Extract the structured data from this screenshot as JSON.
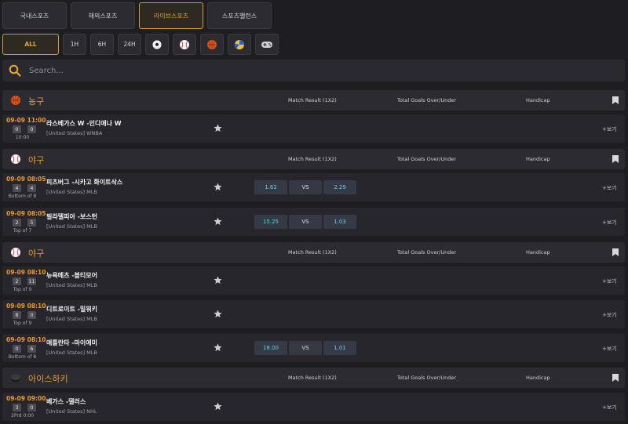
{
  "tabs": [
    "국내스포츠",
    "해외스포츠",
    "라이브스포츠",
    "스포츠밸런스"
  ],
  "active_tab_index": 2,
  "filters": [
    "ALL",
    "1H",
    "6H",
    "24H"
  ],
  "filter_icons": [
    "soccer-icon",
    "baseball-icon",
    "basketball-icon",
    "volleyball-icon",
    "esports-icon"
  ],
  "search": {
    "placeholder": "Search..."
  },
  "columns": {
    "c1": "Match Result (1X2)",
    "c2": "Total Goals Over/Under",
    "c3": "Handicap"
  },
  "more_label": "+보기",
  "odds_vs": "VS",
  "colors": {
    "accent": "#ef9a2b",
    "odds": "#67cfe0"
  },
  "sections": [
    {
      "name": "농구",
      "icon": "basketball-icon"
    },
    {
      "name": "야구",
      "icon": "baseball-icon"
    },
    {
      "name": "야구",
      "icon": "baseball-icon"
    },
    {
      "name": "아이스하키",
      "icon": "hockey-puck-icon"
    }
  ],
  "matches": [
    {
      "time": "09-09 11:00",
      "home_score": "0",
      "away_score": "0",
      "period": "10:00",
      "teams": "라스베가스 W -인디애나 W",
      "league": "[United States] WNBA"
    },
    {
      "time": "09-09 08:05",
      "home_score": "4",
      "away_score": "4",
      "period": "Bottom of 8",
      "teams": "피츠버그 -시카고 화이트삭스",
      "league": "[United States] MLB",
      "odds": [
        "1.62",
        "2.29"
      ]
    },
    {
      "time": "09-09 08:05",
      "home_score": "2",
      "away_score": "5",
      "period": "Top of 7",
      "teams": "필라델피아 -보스턴",
      "league": "[United States] MLB",
      "odds": [
        "15.25",
        "1.03"
      ]
    },
    {
      "time": "09-09 08:10",
      "home_score": "2",
      "away_score": "11",
      "period": "Top of 9",
      "teams": "뉴욕메츠 -볼티모어",
      "league": "[United States] MLB"
    },
    {
      "time": "09-09 08:10",
      "home_score": "8",
      "away_score": "0",
      "period": "Top of 9",
      "teams": "디트로이트 -밀워키",
      "league": "[United States] MLB"
    },
    {
      "time": "09-09 08:10",
      "home_score": "0",
      "away_score": "6",
      "period": "Bottom of 8",
      "teams": "애틀란타 -마이애미",
      "league": "[United States] MLB",
      "odds": [
        "18.00",
        "1.01"
      ]
    },
    {
      "time": "09-09 09:00",
      "home_score": "3",
      "away_score": "0",
      "period": "2Prd 0:00",
      "teams": "베가스 -댈러스",
      "league": "[United States] NHL"
    }
  ]
}
